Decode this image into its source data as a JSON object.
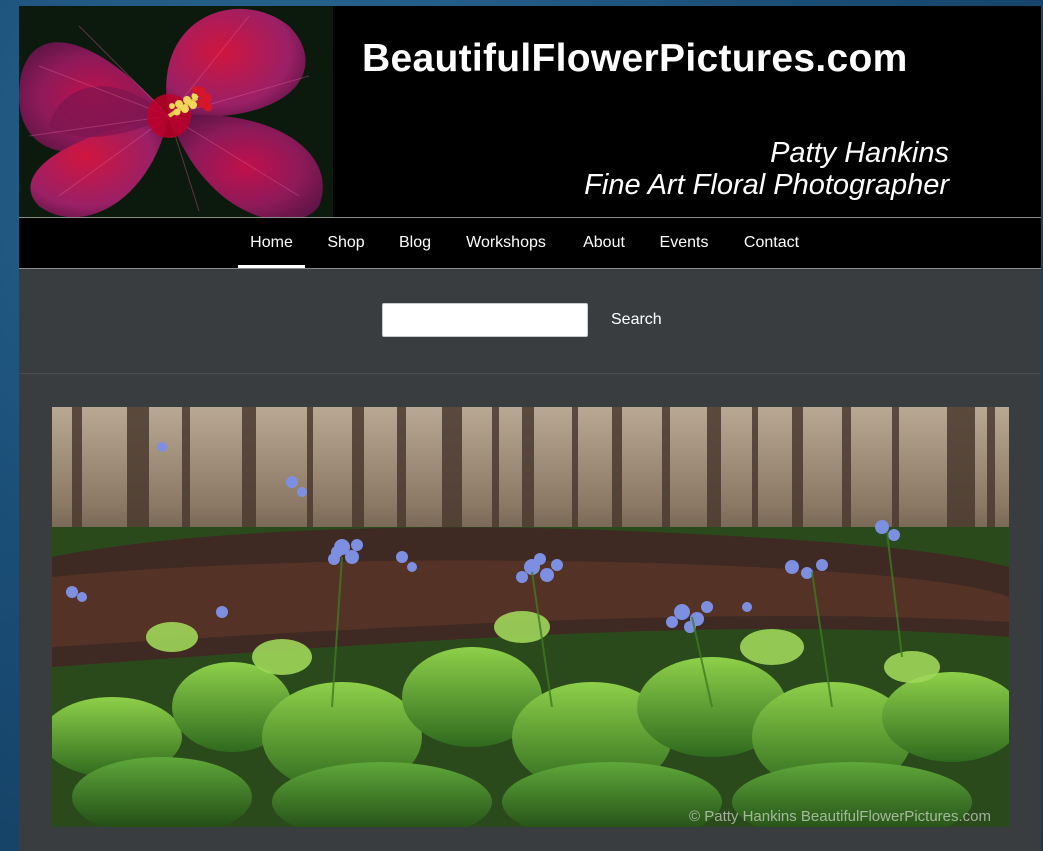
{
  "site": {
    "title": "BeautifulFlowerPictures.com",
    "tagline_name": "Patty Hankins",
    "tagline_role": "Fine Art Floral Photographer"
  },
  "nav": {
    "items": [
      {
        "label": "Home",
        "active": true
      },
      {
        "label": "Shop"
      },
      {
        "label": "Blog"
      },
      {
        "label": "Workshops"
      },
      {
        "label": "About"
      },
      {
        "label": "Events"
      },
      {
        "label": "Contact"
      }
    ]
  },
  "search": {
    "value": "",
    "button_label": "Search"
  },
  "hero": {
    "copyright": "© Patty Hankins BeautifulFlowerPictures.com"
  },
  "colors": {
    "page_background": "#1b4f78",
    "header_background": "#000000",
    "content_background": "#3a3d40",
    "nav_text": "#ffffff"
  }
}
